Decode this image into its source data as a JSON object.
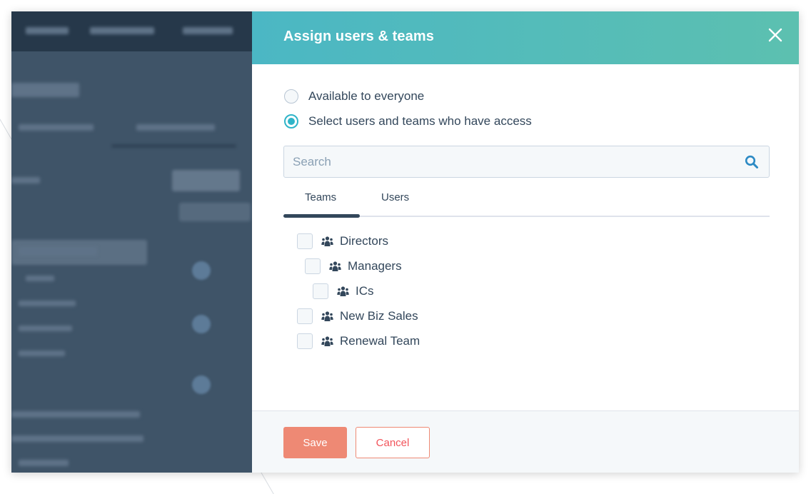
{
  "modal": {
    "title": "Assign users & teams",
    "close_icon": "close-icon"
  },
  "access": {
    "options": [
      {
        "label": "Available to everyone",
        "selected": false
      },
      {
        "label": "Select users and teams who have access",
        "selected": true
      }
    ]
  },
  "search": {
    "placeholder": "Search",
    "value": "",
    "icon": "search-icon"
  },
  "tabs": [
    {
      "label": "Teams",
      "active": true
    },
    {
      "label": "Users",
      "active": false
    }
  ],
  "teams": [
    {
      "name": "Directors",
      "level": 0,
      "checked": false,
      "icon": "team-icon"
    },
    {
      "name": "Managers",
      "level": 1,
      "checked": false,
      "icon": "team-icon"
    },
    {
      "name": "ICs",
      "level": 2,
      "checked": false,
      "icon": "team-icon"
    },
    {
      "name": "New Biz Sales",
      "level": 0,
      "checked": false,
      "icon": "team-icon"
    },
    {
      "name": "Renewal Team",
      "level": 0,
      "checked": false,
      "icon": "team-icon"
    }
  ],
  "footer": {
    "save_label": "Save",
    "cancel_label": "Cancel"
  },
  "colors": {
    "header_gradient_start": "#4bb7c4",
    "header_gradient_end": "#5cc0b0",
    "primary_button": "#ee8974",
    "cancel_text": "#f2545b",
    "radio_accent": "#2fb4c8",
    "text": "#33475b"
  }
}
